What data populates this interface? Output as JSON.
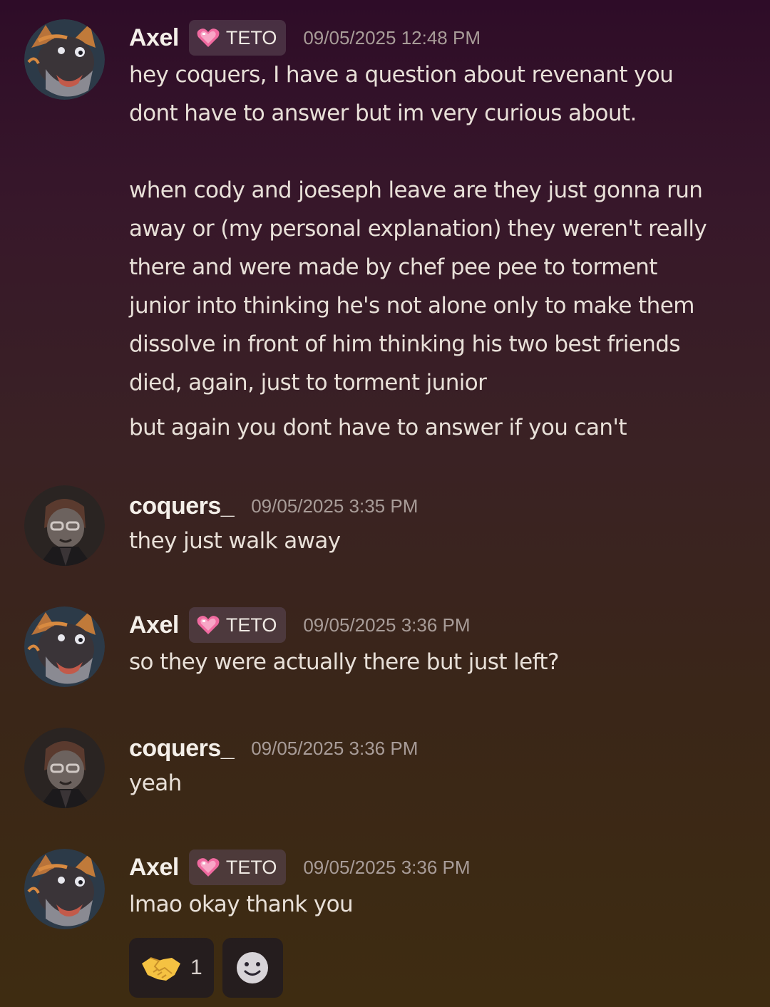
{
  "messages": [
    {
      "username": "Axel",
      "tag": "TETO",
      "timestamp": "09/05/2025 12:48 PM",
      "lines": [
        "hey coquers, I have a question about revenant you",
        "dont have to answer but im very curious about.",
        "",
        "when cody and joeseph leave are they just gonna run",
        "away or (my personal explanation) they weren't really",
        "there and were made by chef pee pee to torment",
        "junior into thinking he's not alone only to make them",
        "dissolve in front of him thinking his two best friends",
        "died, again, just to torment junior"
      ],
      "followup": "but again you dont have to answer if you can't"
    },
    {
      "username": "coquers_",
      "timestamp": "09/05/2025 3:35 PM",
      "text": "they just walk away"
    },
    {
      "username": "Axel",
      "tag": "TETO",
      "timestamp": "09/05/2025 3:36 PM",
      "text": "so they were actually there but just left?"
    },
    {
      "username": "coquers_",
      "timestamp": "09/05/2025 3:36 PM",
      "text": "yeah"
    },
    {
      "username": "Axel",
      "tag": "TETO",
      "timestamp": "09/05/2025 3:36 PM",
      "text": "lmao okay thank you"
    }
  ],
  "reactions": [
    {
      "emoji": "handshake-icon",
      "count": "1"
    },
    {
      "emoji": "add-reaction-icon"
    }
  ],
  "colors": {
    "background_top": "#2e0c28",
    "background_bottom": "#3e2c11",
    "username": "#f4efe9",
    "timestamp": "#a89c98",
    "message_text": "#e8e0d8",
    "tag_background": "#584652"
  }
}
